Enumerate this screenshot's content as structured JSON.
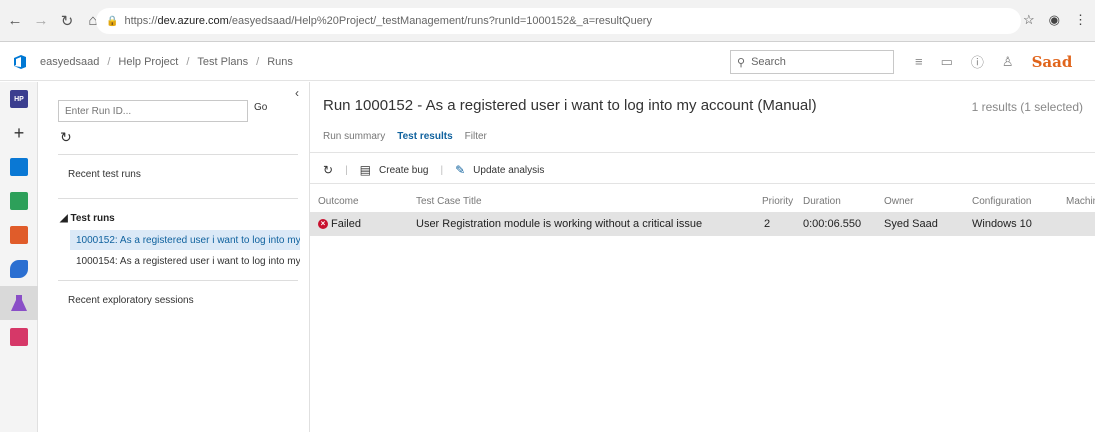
{
  "browser": {
    "url_scheme": "https://",
    "url_host": "dev.azure.com",
    "url_path": "/easyedsaad/Help%20Project/_testManagement/runs?runId=1000152&_a=resultQuery"
  },
  "header": {
    "breadcrumb": [
      "easyedsaad",
      "Help Project",
      "Test Plans",
      "Runs"
    ],
    "search_placeholder": "Search",
    "avatar_text": "Saad"
  },
  "rail": {
    "project_badge": "HP",
    "add_symbol": "+"
  },
  "left_panel": {
    "runid_placeholder": "Enter Run ID...",
    "go_label": "Go",
    "recent_runs_label": "Recent test runs",
    "test_runs_group": "◢ Test runs",
    "runs": [
      {
        "label": "1000152: As a registered user i want to log into my..."
      },
      {
        "label": "1000154: As a registered user i want to log into my..."
      }
    ],
    "recent_exploratory_label": "Recent exploratory sessions"
  },
  "main": {
    "title": "Run 1000152 - As a registered user i want to log into my account (Manual)",
    "results_count": "1 results (1 selected)",
    "tabs": [
      {
        "label": "Run summary"
      },
      {
        "label": "Test results"
      },
      {
        "label": "Filter"
      }
    ],
    "toolbar": {
      "create_bug": "Create bug",
      "update_analysis": "Update analysis"
    },
    "columns": [
      "Outcome",
      "Test Case Title",
      "Priority",
      "Duration",
      "Owner",
      "Configuration",
      "Machin"
    ],
    "rows": [
      {
        "outcome": "Failed",
        "title": "User Registration module is working without a critical issue",
        "priority": "2",
        "duration": "0:00:06.550",
        "owner": "Syed Saad",
        "configuration": "Windows 10",
        "machine": ""
      }
    ]
  },
  "colors": {
    "accent": "#10629e",
    "failed": "#c8102e",
    "selection": "#dbe9f7"
  }
}
